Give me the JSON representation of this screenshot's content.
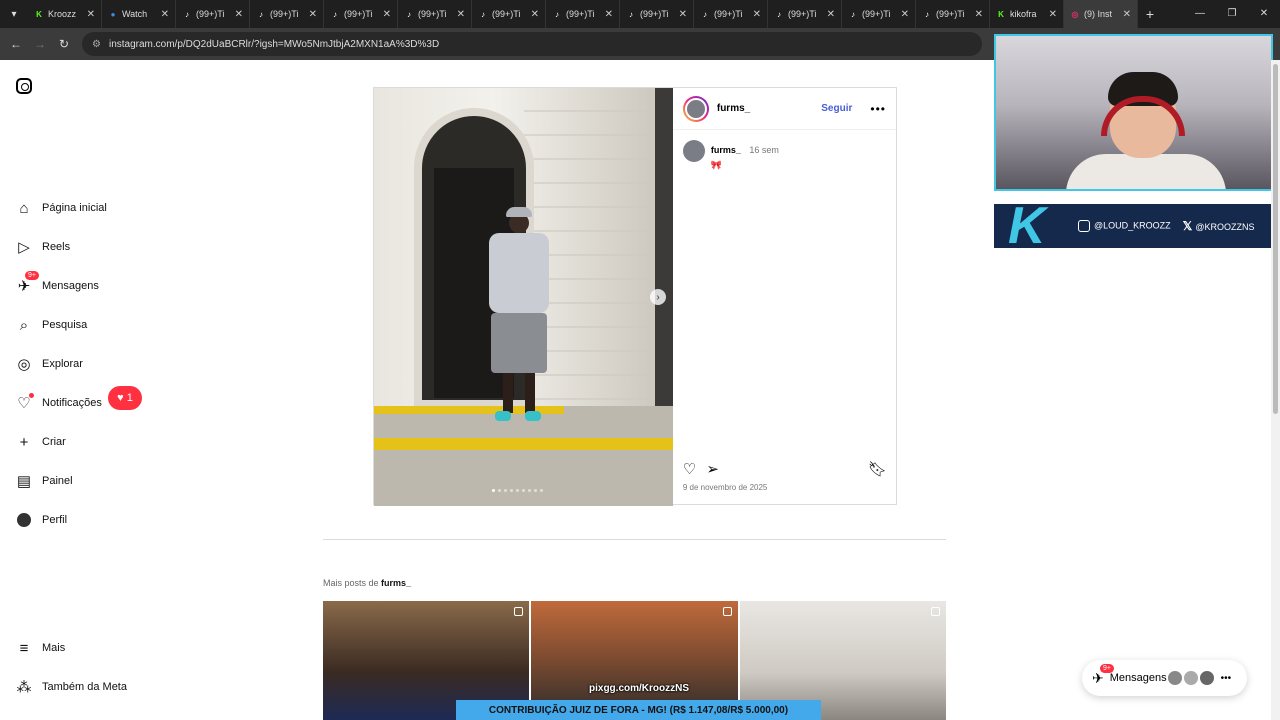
{
  "browser": {
    "tabs": [
      {
        "label": "Kroozz",
        "favicon": "kick-icon",
        "color": "#53fc18"
      },
      {
        "label": "Watch",
        "favicon": "watch-icon",
        "color": "#3a8dde"
      },
      {
        "label": "(99+)Ti",
        "favicon": "tiktok-icon",
        "color": "#ffffff"
      },
      {
        "label": "(99+)Ti",
        "favicon": "tiktok-icon",
        "color": "#ffffff"
      },
      {
        "label": "(99+)Ti",
        "favicon": "tiktok-icon",
        "color": "#ffffff"
      },
      {
        "label": "(99+)Ti",
        "favicon": "tiktok-icon",
        "color": "#ffffff"
      },
      {
        "label": "(99+)Ti",
        "favicon": "tiktok-icon",
        "color": "#ffffff"
      },
      {
        "label": "(99+)Ti",
        "favicon": "tiktok-icon",
        "color": "#ffffff"
      },
      {
        "label": "(99+)Ti",
        "favicon": "tiktok-icon",
        "color": "#ffffff"
      },
      {
        "label": "(99+)Ti",
        "favicon": "tiktok-icon",
        "color": "#ffffff"
      },
      {
        "label": "(99+)Ti",
        "favicon": "tiktok-icon",
        "color": "#ffffff"
      },
      {
        "label": "(99+)Ti",
        "favicon": "tiktok-icon",
        "color": "#ffffff"
      },
      {
        "label": "(99+)Ti",
        "favicon": "tiktok-icon",
        "color": "#ffffff"
      },
      {
        "label": "kikofra",
        "favicon": "kick-icon",
        "color": "#53fc18"
      },
      {
        "label": "(9) Inst",
        "favicon": "instagram-icon",
        "color": "#e1306c",
        "active": true
      }
    ],
    "url": "instagram.com/p/DQ2dUaBCRlr/?igsh=MWo5NmJtbjA2MXN1aA%3D%3D"
  },
  "sidebar": {
    "items": [
      {
        "label": "Página inicial",
        "icon": "home-icon"
      },
      {
        "label": "Reels",
        "icon": "reels-icon"
      },
      {
        "label": "Mensagens",
        "icon": "messenger-icon",
        "badge": "9+"
      },
      {
        "label": "Pesquisa",
        "icon": "search-icon"
      },
      {
        "label": "Explorar",
        "icon": "compass-icon"
      },
      {
        "label": "Notificações",
        "icon": "heart-icon"
      },
      {
        "label": "Criar",
        "icon": "plus-icon"
      },
      {
        "label": "Painel",
        "icon": "dashboard-icon"
      },
      {
        "label": "Perfil",
        "icon": "avatar"
      }
    ],
    "notification_count": "1",
    "bottom": [
      {
        "label": "Mais",
        "icon": "menu-icon"
      },
      {
        "label": "Também da Meta",
        "icon": "meta-icon"
      }
    ]
  },
  "post": {
    "username": "furms_",
    "follow_label": "Seguir",
    "caption_user": "furms_",
    "caption_time": "16 sem",
    "caption_emoji": "🎀",
    "date": "9 de novembro de 2025",
    "carousel_count": 9,
    "carousel_current": 1
  },
  "more_posts": {
    "prefix": "Mais posts de ",
    "username": "furms_"
  },
  "stream": {
    "instagram_handle": "@LOUD_KROOZZ",
    "x_handle": "@KROOZZNS",
    "pix_url": "pixgg.com/KroozzNS",
    "donation_text": "CONTRIBUIÇÃO JUIZ DE FORA - MG! (R$ 1.147,08/R$ 5.000,00)",
    "accent": "#41c7e6"
  },
  "messages_pill": {
    "label": "Mensagens",
    "badge": "9+"
  }
}
